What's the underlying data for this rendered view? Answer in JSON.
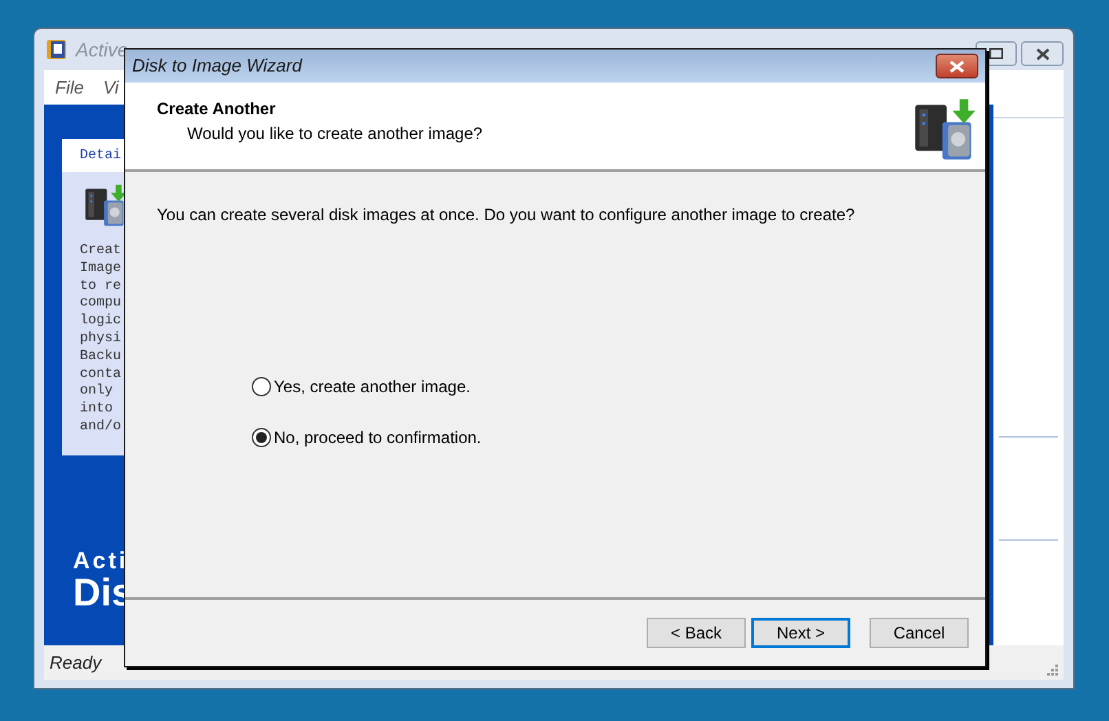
{
  "background_window": {
    "title": "Active",
    "menu": [
      "File",
      "Vi"
    ],
    "details": {
      "heading": "Detai",
      "lines": [
        "Creat",
        "Image",
        "to re",
        "compu",
        "logic",
        "physi",
        "Backu",
        "conta",
        "only",
        "into",
        "and/o"
      ]
    },
    "brand": [
      "Acti",
      "Dis"
    ],
    "status_bar": "Ready"
  },
  "dialog": {
    "title": "Disk to Image Wizard",
    "header": {
      "title": "Create Another",
      "subtitle": "Would you like to create another image?"
    },
    "message": "You can create several disk images at once. Do you want to configure another image to create?",
    "options": [
      {
        "label": "Yes, create another image.",
        "selected": false
      },
      {
        "label": "No, proceed to confirmation.",
        "selected": true
      }
    ],
    "buttons": [
      {
        "label": "< Back",
        "default": false
      },
      {
        "label": "Next >",
        "default": true
      },
      {
        "label": "Cancel",
        "default": false
      }
    ]
  }
}
